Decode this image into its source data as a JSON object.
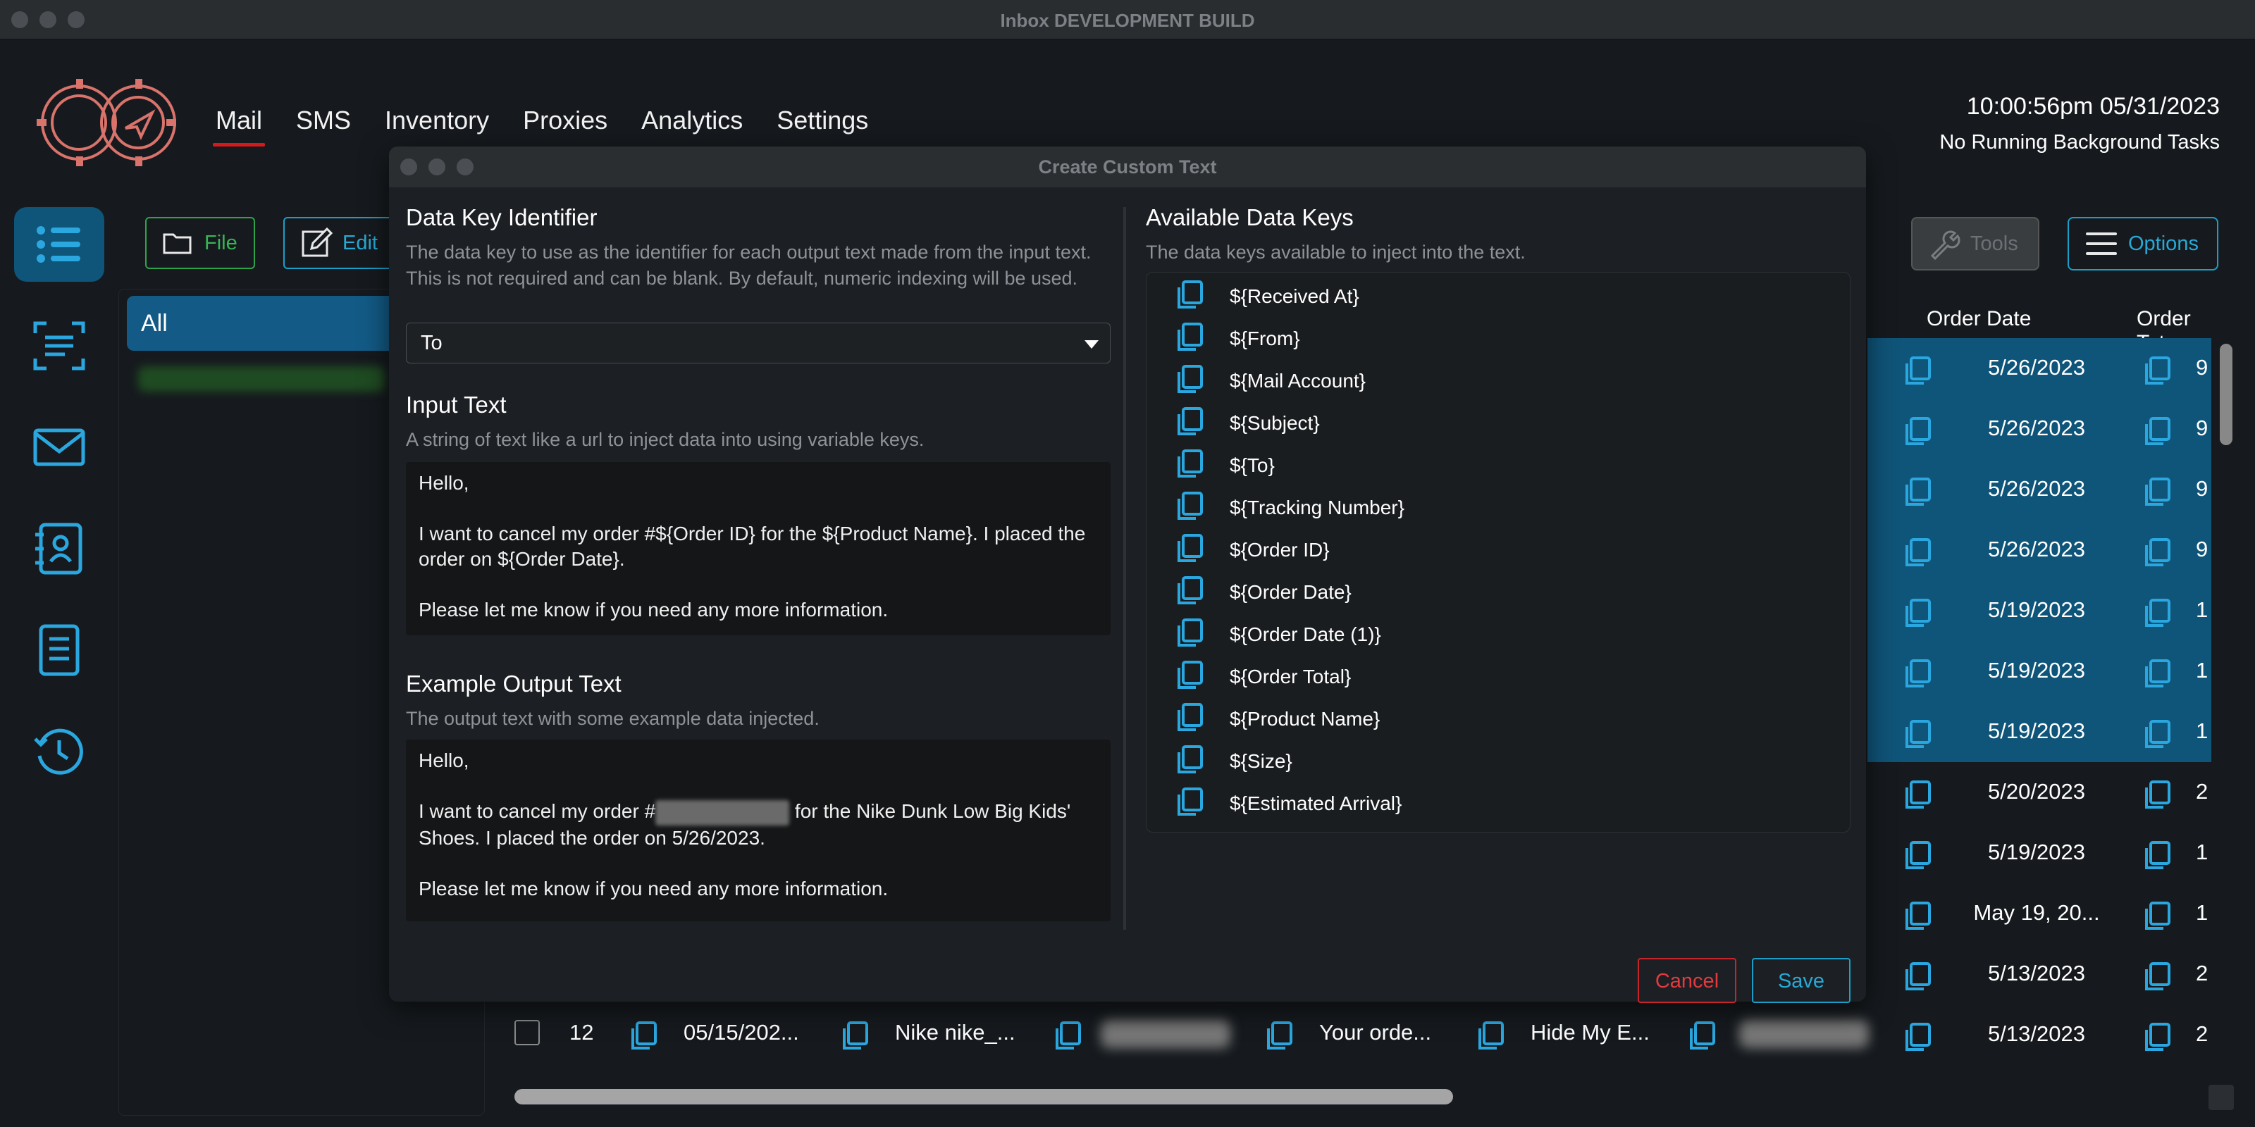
{
  "window": {
    "title": "Inbox DEVELOPMENT BUILD"
  },
  "nav": {
    "items": [
      "Mail",
      "SMS",
      "Inventory",
      "Proxies",
      "Analytics",
      "Settings"
    ],
    "active": "Mail"
  },
  "status": {
    "clock": "10:00:56pm 05/31/2023",
    "background": "No Running Background Tasks"
  },
  "toolbar": {
    "file_label": "File",
    "edit_label": "Edit",
    "tools_label": "Tools",
    "options_label": "Options"
  },
  "folders": {
    "all_label": "All"
  },
  "table": {
    "headers": {
      "order_date": "Order Date",
      "order_total": "Order Tota"
    },
    "rows": [
      {
        "date": "5/26/2023",
        "total": "9",
        "selected": true
      },
      {
        "date": "5/26/2023",
        "total": "9",
        "selected": true
      },
      {
        "date": "5/26/2023",
        "total": "9",
        "selected": true
      },
      {
        "date": "5/26/2023",
        "total": "9",
        "selected": true
      },
      {
        "date": "5/19/2023",
        "total": "1",
        "selected": true
      },
      {
        "date": "5/19/2023",
        "total": "1",
        "selected": true
      },
      {
        "date": "5/19/2023",
        "total": "1",
        "selected": true
      },
      {
        "date": "5/20/2023",
        "total": "2",
        "selected": false
      },
      {
        "date": "5/19/2023",
        "total": "1",
        "selected": false
      },
      {
        "date": "May 19, 20...",
        "total": "1",
        "selected": false
      },
      {
        "date": "5/13/2023",
        "total": "2",
        "selected": false
      },
      {
        "date": "5/13/2023",
        "total": "2",
        "selected": false
      }
    ],
    "bottom_row": {
      "index": "12",
      "date": "05/15/202...",
      "product": "Nike nike_...",
      "subject": "Your orde...",
      "mail_account": "Hide My E..."
    }
  },
  "modal": {
    "title": "Create Custom Text",
    "data_key": {
      "title": "Data Key Identifier",
      "description": "The data key to use as the identifier for each output text made from the input text. This is not required and can be blank. By default, numeric indexing will be used.",
      "value": "To"
    },
    "input_text": {
      "title": "Input Text",
      "description": "A string of text like a url to inject data into using variable keys.",
      "value": "Hello,\n\nI want to cancel my order #${Order ID} for the ${Product Name}. I placed the order on ${Order Date}.\n\nPlease let me know if you need any more information."
    },
    "example_output": {
      "title": "Example Output Text",
      "description": "The output text with some example data injected.",
      "line1": "Hello,",
      "line2_pre": "I want to cancel my order #",
      "line2_post": " for the Nike Dunk Low Big Kids' Shoes. I placed the order on 5/26/2023.",
      "line3": "Please let me know if you need any more information."
    },
    "available_keys": {
      "title": "Available Data Keys",
      "description": "The data keys available to inject into the text.",
      "keys": [
        "${Received At}",
        "${From}",
        "${Mail Account}",
        "${Subject}",
        "${To}",
        "${Tracking Number}",
        "${Order ID}",
        "${Order Date}",
        "${Order Date (1)}",
        "${Order Total}",
        "${Product Name}",
        "${Size}",
        "${Estimated Arrival}"
      ]
    },
    "cancel_label": "Cancel",
    "save_label": "Save"
  }
}
